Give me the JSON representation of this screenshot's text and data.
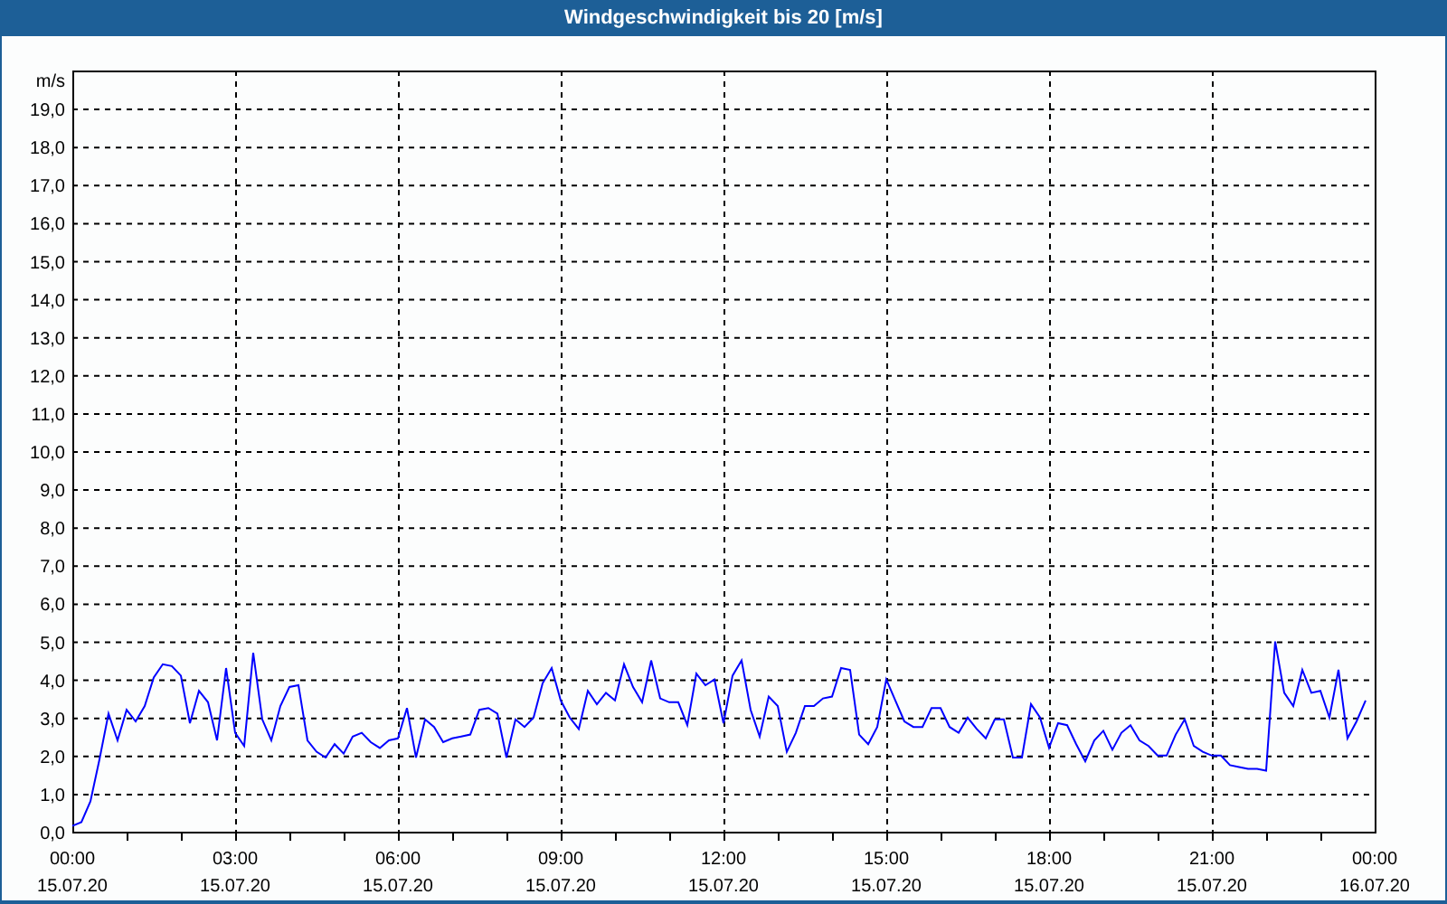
{
  "window": {
    "title": "Windgeschwindigkeit bis 20 [m/s]"
  },
  "chart_data": {
    "type": "line",
    "grid": true,
    "ylabel": "m/s",
    "categories": [
      "00:00 15.07.20",
      null,
      null,
      null,
      null,
      null,
      null,
      null,
      null,
      null,
      null,
      null,
      null,
      null,
      null,
      null,
      null,
      null,
      "03:00 15.07.20",
      null,
      null,
      null,
      null,
      null,
      null,
      null,
      null,
      null,
      null,
      null,
      null,
      null,
      null,
      null,
      null,
      null,
      "06:00 15.07.20",
      null,
      null,
      null,
      null,
      null,
      null,
      null,
      null,
      null,
      null,
      null,
      null,
      null,
      null,
      null,
      null,
      null,
      "09:00 15.07.20",
      null,
      null,
      null,
      null,
      null,
      null,
      null,
      null,
      null,
      null,
      null,
      null,
      null,
      null,
      null,
      null,
      null,
      "12:00 15.07.20",
      null,
      null,
      null,
      null,
      null,
      null,
      null,
      null,
      null,
      null,
      null,
      null,
      null,
      null,
      null,
      null,
      null,
      "15:00 15.07.20",
      null,
      null,
      null,
      null,
      null,
      null,
      null,
      null,
      null,
      null,
      null,
      null,
      null,
      null,
      null,
      null,
      null,
      "18:00 15.07.20",
      null,
      null,
      null,
      null,
      null,
      null,
      null,
      null,
      null,
      null,
      null,
      null,
      null,
      null,
      null,
      null,
      null,
      "21:00 15.07.20",
      null,
      null,
      null,
      null,
      null,
      null,
      null,
      null,
      null,
      null,
      null,
      null,
      null,
      null,
      null,
      null,
      null,
      "00:00 16.07.20"
    ],
    "series": [
      {
        "color": "#0000ff",
        "values": [
          0.15,
          0.25,
          0.8,
          1.9,
          3.1,
          2.4,
          3.2,
          2.9,
          3.3,
          4.05,
          4.4,
          4.35,
          4.1,
          2.85,
          3.7,
          3.4,
          2.4,
          4.3,
          2.6,
          2.25,
          4.7,
          2.95,
          2.4,
          3.3,
          3.8,
          3.85,
          2.4,
          2.1,
          1.95,
          2.3,
          2.05,
          2.5,
          2.6,
          2.35,
          2.2,
          2.4,
          2.45,
          3.25,
          1.95,
          2.95,
          2.75,
          2.35,
          2.45,
          2.5,
          2.55,
          3.2,
          3.25,
          3.1,
          1.95,
          2.95,
          2.75,
          3.0,
          3.9,
          4.3,
          3.45,
          3.0,
          2.7,
          3.7,
          3.35,
          3.65,
          3.45,
          4.4,
          3.8,
          3.4,
          4.5,
          3.5,
          3.4,
          3.4,
          2.8,
          4.15,
          3.85,
          4.0,
          2.85,
          4.1,
          4.5,
          3.2,
          2.5,
          3.55,
          3.3,
          2.1,
          2.6,
          3.3,
          3.3,
          3.5,
          3.55,
          4.3,
          4.25,
          2.55,
          2.3,
          2.75,
          4.0,
          3.45,
          2.9,
          2.75,
          2.75,
          3.25,
          3.25,
          2.75,
          2.6,
          3.0,
          2.7,
          2.45,
          2.95,
          2.95,
          1.95,
          1.95,
          3.35,
          3.0,
          2.2,
          2.85,
          2.8,
          2.3,
          1.85,
          2.4,
          2.65,
          2.15,
          2.6,
          2.8,
          2.4,
          2.25,
          2.0,
          2.0,
          2.55,
          2.95,
          2.25,
          2.1,
          2.0,
          2.0,
          1.75,
          1.7,
          1.65,
          1.65,
          1.6,
          5.0,
          3.65,
          3.3,
          4.25,
          3.65,
          3.7,
          3.0,
          4.25,
          2.45,
          2.9,
          3.45,
          null
        ]
      }
    ],
    "ylim": [
      0,
      20
    ],
    "yticks": [
      {
        "value": 0,
        "label": "0,0"
      },
      {
        "value": 1,
        "label": "1,0"
      },
      {
        "value": 2,
        "label": "2,0"
      },
      {
        "value": 3,
        "label": "3,0"
      },
      {
        "value": 4,
        "label": "4,0"
      },
      {
        "value": 5,
        "label": "5,0"
      },
      {
        "value": 6,
        "label": "6,0"
      },
      {
        "value": 7,
        "label": "7,0"
      },
      {
        "value": 8,
        "label": "8,0"
      },
      {
        "value": 9,
        "label": "9,0"
      },
      {
        "value": 10,
        "label": "10,0"
      },
      {
        "value": 11,
        "label": "11,0"
      },
      {
        "value": 12,
        "label": "12,0"
      },
      {
        "value": 13,
        "label": "13,0"
      },
      {
        "value": 14,
        "label": "14,0"
      },
      {
        "value": 15,
        "label": "15,0"
      },
      {
        "value": 16,
        "label": "16,0"
      },
      {
        "value": 17,
        "label": "17,0"
      },
      {
        "value": 18,
        "label": "18,0"
      },
      {
        "value": 19,
        "label": "19,0"
      }
    ]
  }
}
